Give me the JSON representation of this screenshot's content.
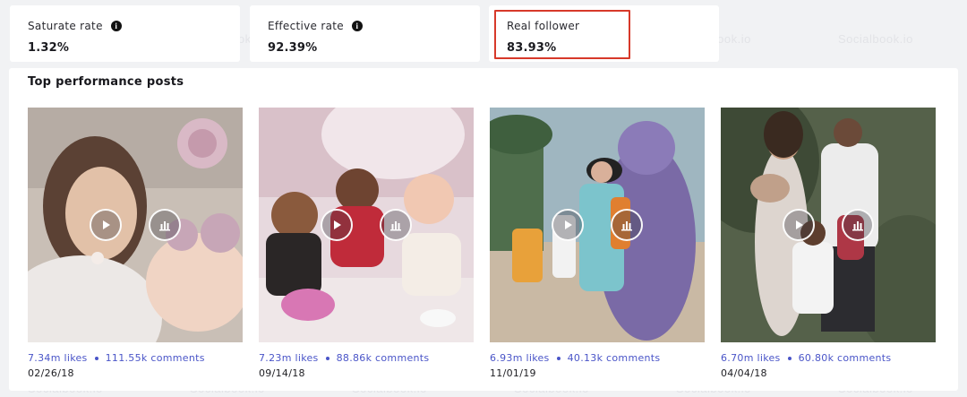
{
  "watermark": "Socialbook.io",
  "stats": [
    {
      "label": "Saturate rate",
      "value": "1.32%",
      "info_icon": "info-icon"
    },
    {
      "label": "Effective rate",
      "value": "92.39%",
      "info_icon": "info-icon"
    },
    {
      "label": "Real follower",
      "value": "83.93%"
    }
  ],
  "section": {
    "title": "Top performance posts"
  },
  "posts": [
    {
      "likes": "7.34m likes",
      "comments": "111.55k comments",
      "date": "02/26/18"
    },
    {
      "likes": "7.23m likes",
      "comments": "88.86k comments",
      "date": "09/14/18"
    },
    {
      "likes": "6.93m likes",
      "comments": "40.13k comments",
      "date": "11/01/19"
    },
    {
      "likes": "6.70m likes",
      "comments": "60.80k comments",
      "date": "04/04/18"
    }
  ],
  "colors": {
    "accent": "#4a55c8",
    "highlight": "#d7392a"
  }
}
